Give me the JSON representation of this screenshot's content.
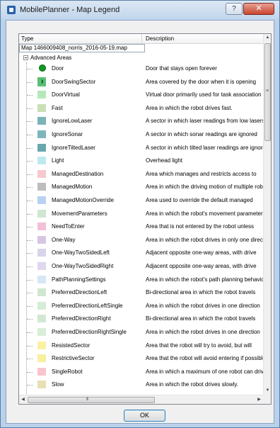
{
  "window": {
    "title": "MobilePlanner - Map Legend",
    "help_glyph": "?",
    "close_glyph": "✕"
  },
  "tree": {
    "columns": {
      "type": "Type",
      "description": "Description"
    },
    "map_name": "Map 1466009408_norris_2016-05-19.map",
    "group_label": "Advanced Areas",
    "items": [
      {
        "name": "Door",
        "description": "Door that stays open forever",
        "icon": "door-circle-icon",
        "color": "#0a9a20"
      },
      {
        "name": "DoorSwingSector",
        "description": "Area covered by the door when it is opening",
        "icon": "door-swing-icon",
        "color": "#5bbf76"
      },
      {
        "name": "DoorVirtual",
        "description": "Virtual door primarily used for task association",
        "color": "#b5e8b8"
      },
      {
        "name": "Fast",
        "description": "Area in which the robot drives fast.",
        "color": "#c8e0b4"
      },
      {
        "name": "IgnoreLowLaser",
        "description": "A sector in which laser readings from low lasers",
        "color": "#7bb3b9"
      },
      {
        "name": "IgnoreSonar",
        "description": "A sector in which sonar readings are ignored",
        "color": "#7fb6bc"
      },
      {
        "name": "IgnoreTiltedLaser",
        "description": "A sector in which tilted laser readings are ignored",
        "color": "#6aa7ad"
      },
      {
        "name": "Light",
        "description": "Overhead light",
        "color": "#bfe9f1"
      },
      {
        "name": "ManagedDestination",
        "description": "Area which manages and restricts access to",
        "color": "#f6c8cf"
      },
      {
        "name": "ManagedMotion",
        "description": "Area in which the driving motion of multiple robots",
        "color": "#bdbdbd"
      },
      {
        "name": "ManagedMotionOverride",
        "description": "Area used to override the default managed",
        "color": "#b8d1f2"
      },
      {
        "name": "MovementParameters",
        "description": "Area in which the robot's movement parameters",
        "color": "#cfe6cf"
      },
      {
        "name": "NeedToEnter",
        "description": "Area that is not entered by the robot unless",
        "color": "#f3bfd6"
      },
      {
        "name": "One-Way",
        "description": "Area in which the robot drives in only one direction",
        "color": "#d6c6e4"
      },
      {
        "name": "One-WayTwoSidedLeft",
        "description": "Adjacent opposite one-way areas, with drive",
        "color": "#d9d2eb"
      },
      {
        "name": "One-WayTwoSidedRight",
        "description": "Adjacent opposite one-way areas, with drive",
        "color": "#e0d6ef"
      },
      {
        "name": "PathPlanningSettings",
        "description": "Area in which the robot's path planning behavior",
        "color": "#d7e6f4"
      },
      {
        "name": "PreferredDirectionLeft",
        "description": "Bi-directional area in which the robot travels",
        "color": "#cfe7cf"
      },
      {
        "name": "PreferredDirectionLeftSingle",
        "description": "Area in which the robot drives in one direction",
        "color": "#d6ecd6"
      },
      {
        "name": "PreferredDirectionRight",
        "description": "Bi-directional area in which the robot travels",
        "color": "#d2e7d2"
      },
      {
        "name": "PreferredDirectionRightSingle",
        "description": "Area in which the robot drives in one direction",
        "color": "#d9eed9"
      },
      {
        "name": "ResistedSector",
        "description": "Area that the robot will try to avoid, but will",
        "color": "#fbf1a3"
      },
      {
        "name": "RestrictiveSector",
        "description": "Area that the robot will avoid entering if possible",
        "color": "#f8ef9f"
      },
      {
        "name": "SingleRobot",
        "description": "Area in which a maximum of one robot can drive",
        "color": "#f8c5cf"
      },
      {
        "name": "Slow",
        "description": "Area in which the robot drives slowly.",
        "color": "#e6e0b4"
      }
    ]
  },
  "ok_button": {
    "label": "OK"
  }
}
